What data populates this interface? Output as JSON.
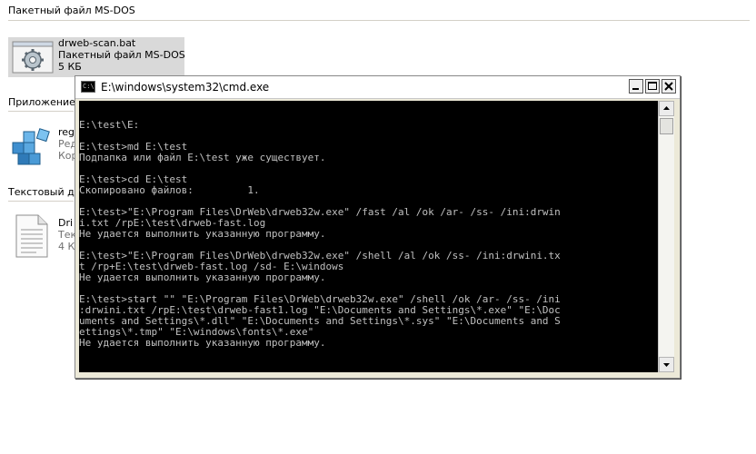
{
  "explorer": {
    "groups": [
      {
        "header": "Пакетный файл MS-DOS"
      },
      {
        "header": "Приложение"
      },
      {
        "header": "Текстовый д"
      }
    ],
    "files": [
      {
        "name": "drweb-scan.bat",
        "type": "Пакетный файл MS-DOS",
        "size": "5 КБ",
        "icon": "gear-batch-icon"
      },
      {
        "name": "reg",
        "type": "Ред",
        "size": "Кор",
        "icon": "registry-cubes-icon"
      },
      {
        "name": "Dri",
        "type": "Тек",
        "size": "4 К",
        "icon": "text-document-icon"
      }
    ]
  },
  "cmd": {
    "title": "E:\\windows\\system32\\cmd.exe",
    "icon_text": "C:\\",
    "console_lines": [
      "",
      "E:\\test\\E:",
      "",
      "E:\\test>md E:\\test",
      "Подпапка или файл E:\\test уже существует.",
      "",
      "E:\\test>cd E:\\test",
      "Скопировано файлов:         1.",
      "",
      "E:\\test>\"E:\\Program Files\\DrWeb\\drweb32w.exe\" /fast /al /ok /ar- /ss- /ini:drwin",
      "i.txt /rpE:\\test\\drweb-fast.log",
      "Не удается выполнить указанную программу.",
      "",
      "E:\\test>\"E:\\Program Files\\DrWeb\\drweb32w.exe\" /shell /al /ok /ss- /ini:drwini.tx",
      "t /rp+E:\\test\\drweb-fast.log /sd- E:\\windows",
      "Не удается выполнить указанную программу.",
      "",
      "E:\\test>start \"\" \"E:\\Program Files\\DrWeb\\drweb32w.exe\" /shell /ok /ar- /ss- /ini",
      ":drwini.txt /rpE:\\test\\drweb-fast1.log \"E:\\Documents and Settings\\*.exe\" \"E:\\Doc",
      "uments and Settings\\*.dll\" \"E:\\Documents and Settings\\*.sys\" \"E:\\Documents and S",
      "ettings\\*.tmp\" \"E:\\windows\\fonts\\*.exe\"",
      "Не удается выполнить указанную программу."
    ]
  }
}
